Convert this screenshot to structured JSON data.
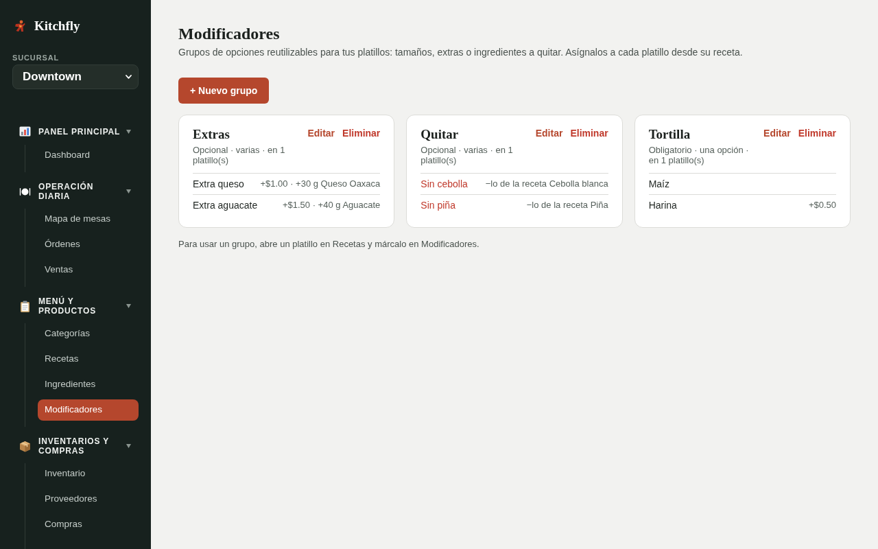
{
  "sidebar": {
    "brand": "Kitchfly",
    "branch": {
      "label": "SUCURSAL",
      "value": "Downtown"
    },
    "sections": [
      {
        "title": "PANEL PRINCIPAL",
        "kind": "chart",
        "expanded": true,
        "items": [
          {
            "label": "Dashboard",
            "selected": false
          }
        ]
      },
      {
        "title": "OPERACIÓN DIARIA",
        "kind": "dining",
        "expanded": true,
        "items": [
          {
            "label": "Mapa de mesas",
            "selected": false
          },
          {
            "label": "Órdenes",
            "selected": false
          },
          {
            "label": "Ventas",
            "selected": false
          }
        ]
      },
      {
        "title": "MENÚ Y PRODUCTOS",
        "kind": "clipboard",
        "expanded": true,
        "items": [
          {
            "label": "Categorías",
            "selected": false
          },
          {
            "label": "Recetas",
            "selected": false
          },
          {
            "label": "Ingredientes",
            "selected": false
          },
          {
            "label": "Modificadores",
            "selected": true
          }
        ]
      },
      {
        "title": "INVENTARIOS Y COMPRAS",
        "kind": "package",
        "expanded": true,
        "items": [
          {
            "label": "Inventario",
            "selected": false
          },
          {
            "label": "Proveedores",
            "selected": false
          },
          {
            "label": "Compras",
            "selected": false
          }
        ]
      }
    ]
  },
  "page": {
    "title": "Modificadores",
    "subtitle": "Grupos de opciones reutilizables para tus platillos: tamaños, extras o ingredientes a quitar. Asígnalos a cada platillo desde su receta.",
    "new_button": "+ Nuevo grupo",
    "groups": [
      {
        "name": "Extras",
        "meta": "Opcional · varias · en 1 platillo(s)",
        "actions": [
          {
            "label": "Editar",
            "kind": "edit"
          },
          {
            "label": "Eliminar",
            "kind": "delete"
          }
        ],
        "options": [
          {
            "name": "Extra queso",
            "kind": "extra",
            "detail": "+$1.00 · +30 g Queso Oaxaca"
          },
          {
            "name": "Extra aguacate",
            "kind": "extra",
            "detail": "+$1.50 · +40 g Aguacate"
          }
        ]
      },
      {
        "name": "Quitar",
        "meta": "Opcional · varias · en 1 platillo(s)",
        "actions": [
          {
            "label": "Editar",
            "kind": "edit"
          },
          {
            "label": "Eliminar",
            "kind": "delete"
          }
        ],
        "options": [
          {
            "name": "Sin cebolla",
            "kind": "remove",
            "detail": "−lo de la receta Cebolla blanca"
          },
          {
            "name": "Sin piña",
            "kind": "remove",
            "detail": "−lo de la receta Piña"
          }
        ]
      },
      {
        "name": "Tortilla",
        "meta": "Obligatorio · una opción · en 1 platillo(s)",
        "actions": [
          {
            "label": "Editar",
            "kind": "edit"
          },
          {
            "label": "Eliminar",
            "kind": "delete"
          }
        ],
        "options": [
          {
            "name": "Maíz",
            "kind": "choice"
          },
          {
            "name": "Harina",
            "kind": "choice",
            "detail": "+$0.50"
          }
        ]
      }
    ],
    "footer_note": "Para usar un grupo, abre un platillo en Recetas y márcalo en Modificadores."
  }
}
